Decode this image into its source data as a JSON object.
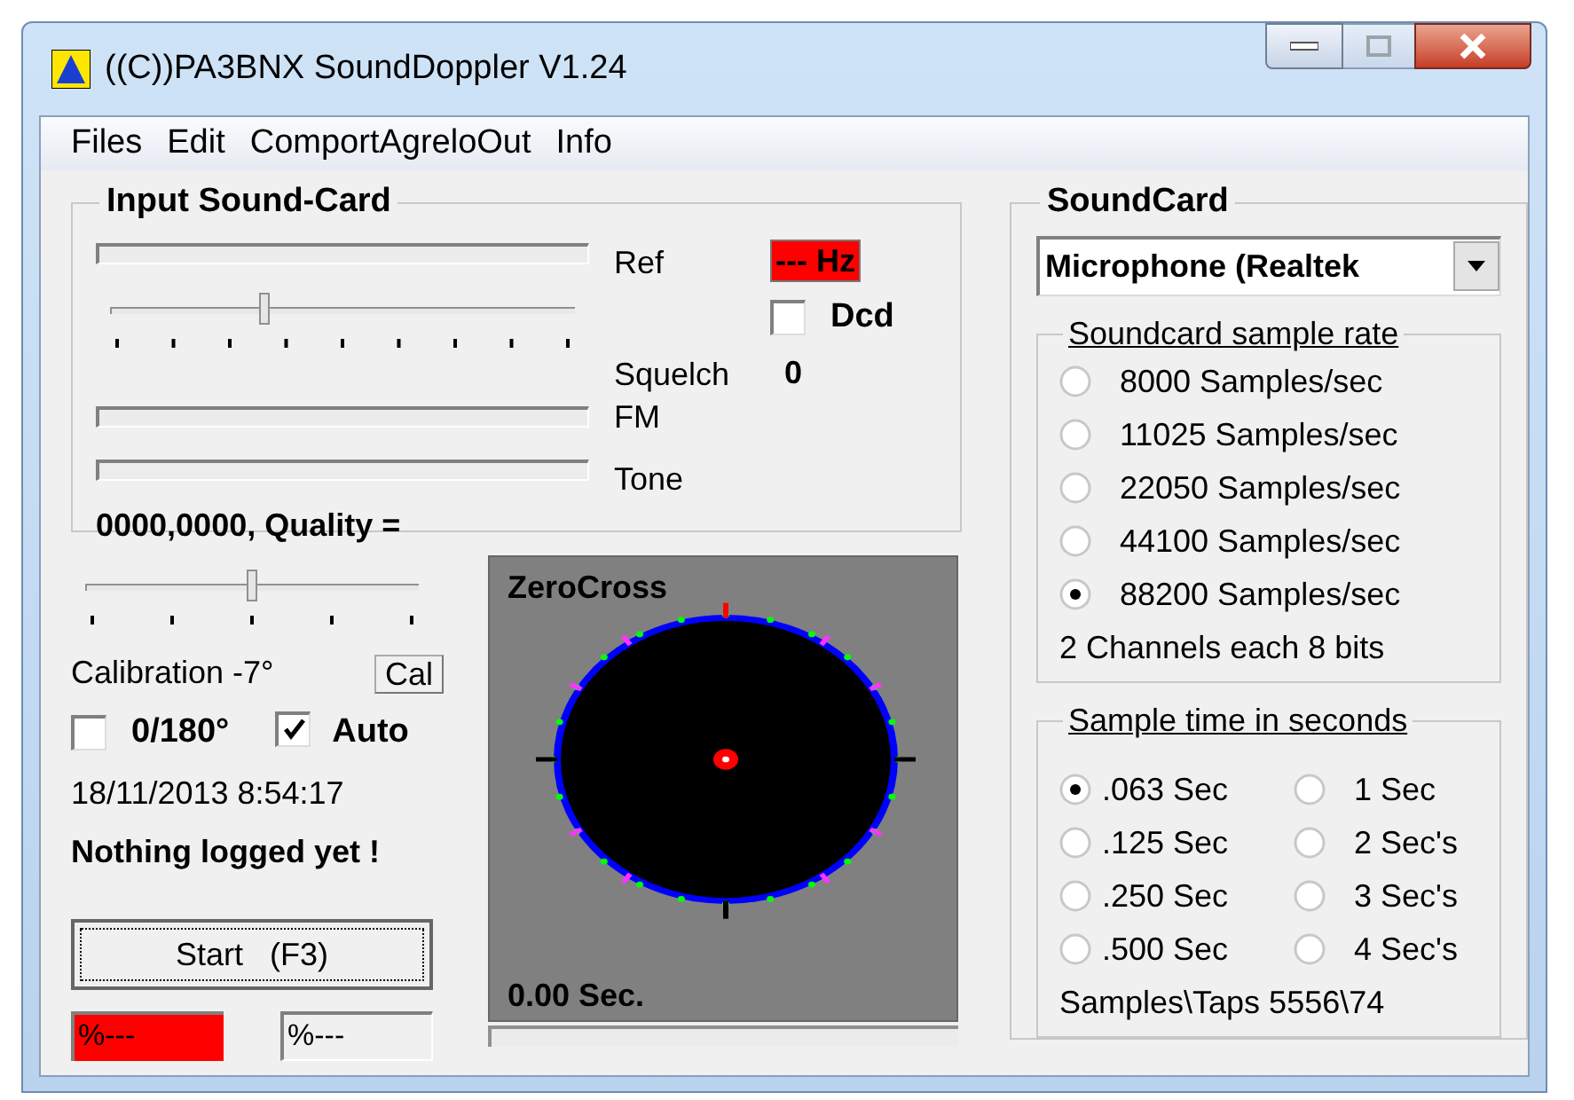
{
  "window": {
    "title": "((C))PA3BNX SoundDoppler V1.24"
  },
  "menu": [
    "Files",
    "Edit",
    "ComportAgreloOut",
    "Info"
  ],
  "input_sound_card": {
    "title": "Input Sound-Card",
    "ref": {
      "label": "Ref",
      "level": 0
    },
    "squelch": {
      "label": "Squelch",
      "level": 0.33
    },
    "fm": {
      "label": "FM",
      "level": 0
    },
    "tone": {
      "label": "Tone",
      "level": 0
    },
    "frequency": "--- Hz",
    "dcd": {
      "label": "Dcd",
      "checked": false
    },
    "squelch_value": "0",
    "position_quality": "0000,0000, Quality ="
  },
  "calibration": {
    "level": 0.5,
    "label": "Calibration -7°",
    "button": "Cal"
  },
  "flip": {
    "label": "0/180°",
    "checked": false
  },
  "auto": {
    "label": "Auto",
    "checked": true
  },
  "timestamp": "18/11/2013 8:54:17",
  "log_status": "Nothing logged yet !",
  "start_button": "Start   (F3)",
  "percent_fields": [
    {
      "text": "%---",
      "alert": true
    },
    {
      "text": "%---",
      "alert": false
    }
  ],
  "zerocross": {
    "title": "ZeroCross",
    "time": "0.00 Sec.",
    "progress": {
      "level": 0
    }
  },
  "soundcard": {
    "title": "SoundCard",
    "device": "Microphone (Realtek",
    "sample_rate": {
      "title": "Soundcard sample rate",
      "options": [
        {
          "label": "8000 Samples/sec",
          "selected": false
        },
        {
          "label": "11025 Samples/sec",
          "selected": false
        },
        {
          "label": "22050 Samples/sec",
          "selected": false
        },
        {
          "label": "44100 Samples/sec",
          "selected": false
        },
        {
          "label": "88200 Samples/sec",
          "selected": true
        }
      ],
      "info": "2 Channels each 8 bits"
    },
    "sample_time": {
      "title": "Sample time in seconds",
      "options": [
        {
          "label": ".063 Sec",
          "selected": true
        },
        {
          "label": "1 Sec",
          "selected": false
        },
        {
          "label": ".125 Sec",
          "selected": false
        },
        {
          "label": "2 Sec's",
          "selected": false
        },
        {
          "label": ".250 Sec",
          "selected": false
        },
        {
          "label": "3 Sec's",
          "selected": false
        },
        {
          "label": ".500 Sec",
          "selected": false
        },
        {
          "label": "4 Sec's",
          "selected": false
        }
      ],
      "info": "Samples\\Taps 5556\\74"
    }
  }
}
